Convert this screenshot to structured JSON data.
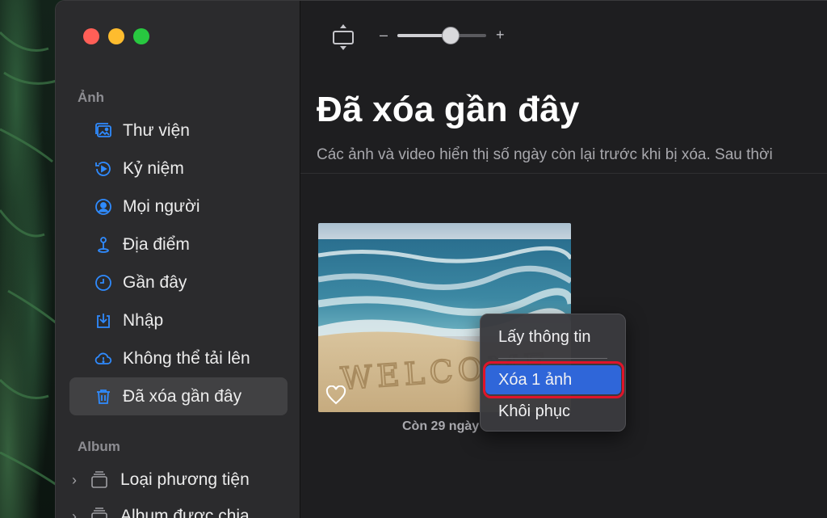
{
  "sidebar": {
    "section_photos": "Ảnh",
    "items": [
      {
        "label": "Thư viện",
        "icon": "photo-library-icon"
      },
      {
        "label": "Kỷ niệm",
        "icon": "memories-icon"
      },
      {
        "label": "Mọi người",
        "icon": "people-icon"
      },
      {
        "label": "Địa điểm",
        "icon": "places-pin-icon"
      },
      {
        "label": "Gần đây",
        "icon": "clock-icon"
      },
      {
        "label": "Nhập",
        "icon": "import-icon"
      },
      {
        "label": "Không thể tải lên",
        "icon": "cloud-alert-icon"
      },
      {
        "label": "Đã xóa gần đây",
        "icon": "trash-icon",
        "active": true
      }
    ],
    "section_albums": "Album",
    "albums": [
      {
        "label": "Loại phương tiện"
      },
      {
        "label": "Album được chia"
      }
    ]
  },
  "toolbar": {
    "zoom_minus": "–",
    "zoom_plus": "+",
    "zoom_level": 0.62
  },
  "main": {
    "title": "Đã xóa gần đây",
    "subtitle": "Các ảnh và video hiển thị số ngày còn lại trước khi bị xóa. Sau thời",
    "photo_caption": "Còn 29 ngày"
  },
  "context_menu": {
    "items": [
      "Lấy thông tin",
      "Xóa 1 ảnh",
      "Khôi phục"
    ],
    "selected": "Xóa 1 ảnh"
  },
  "colors": {
    "accent_blue": "#2f66d9",
    "icon_blue": "#2f8bff",
    "highlight_red": "#e0142a"
  }
}
